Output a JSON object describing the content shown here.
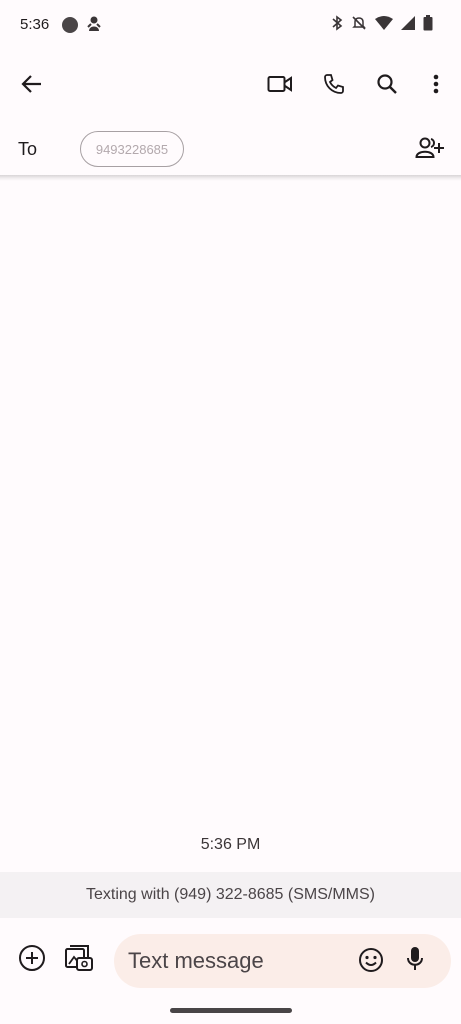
{
  "status_bar": {
    "time": "5:36",
    "icons": [
      "circle-icon",
      "notification-icon",
      "bluetooth-icon",
      "mute-icon",
      "wifi-icon",
      "signal-icon",
      "battery-icon"
    ]
  },
  "app_bar": {
    "icons": [
      "back-arrow-icon",
      "video-call-icon",
      "phone-icon",
      "search-icon",
      "more-vert-icon"
    ]
  },
  "recipient": {
    "to_label": "To",
    "chip": "9493228685"
  },
  "conversation": {
    "timestamp": "5:36 PM",
    "banner": "Texting with (949) 322-8685 (SMS/MMS)"
  },
  "compose": {
    "placeholder": "Text message",
    "icons": [
      "add-circle-icon",
      "gallery-icon",
      "emoji-icon",
      "mic-icon"
    ]
  },
  "colors": {
    "background": "#fffbfd",
    "compose_field": "#fbede8",
    "banner": "#f4f1f3"
  }
}
